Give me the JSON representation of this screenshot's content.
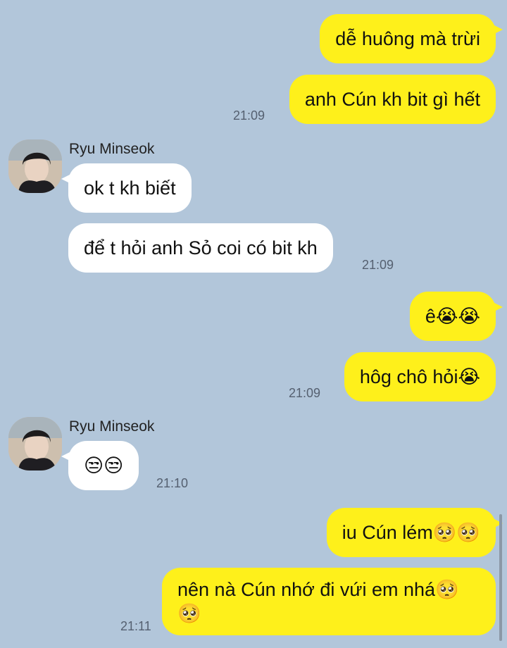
{
  "chat": {
    "contact_name": "Ryu Minseok",
    "messages": [
      {
        "from": "me",
        "text": "dễ huông mà trừi"
      },
      {
        "from": "me",
        "text": "anh Cún kh bit gì hết",
        "time": "21:09"
      },
      {
        "from": "other",
        "sender": "Ryu Minseok",
        "text": "ok t kh biết"
      },
      {
        "from": "other",
        "text": "để t hỏi anh Sỏ coi có bit kh",
        "time": "21:09"
      },
      {
        "from": "me",
        "text": "ê😭😭"
      },
      {
        "from": "me",
        "text": "hôg chô hỏi😭",
        "time": "21:09"
      },
      {
        "from": "other",
        "sender": "Ryu Minseok",
        "text": "😒😒",
        "time": "21:10"
      },
      {
        "from": "me",
        "text": "iu Cún lém🥺🥺"
      },
      {
        "from": "me",
        "text": "nên nà Cún nhớ đi vứi em nhá🥺🥺",
        "time": "21:11"
      }
    ]
  },
  "colors": {
    "background": "#b2c6da",
    "my_bubble": "#fef01b",
    "other_bubble": "#ffffff"
  }
}
